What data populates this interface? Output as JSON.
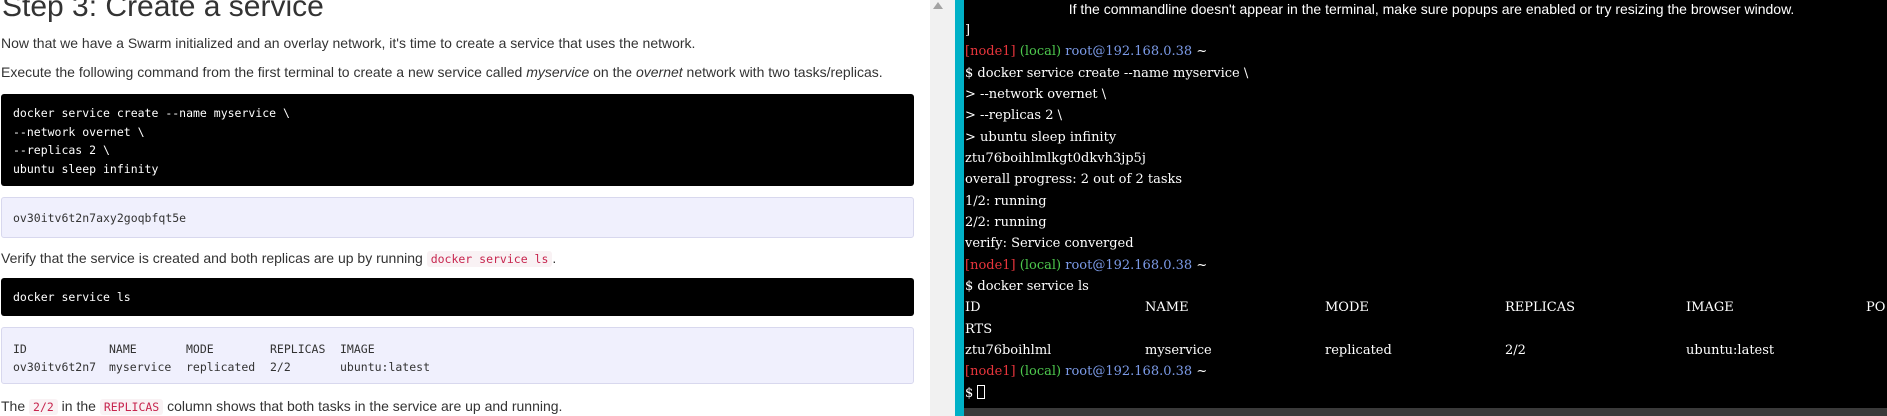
{
  "tutorial": {
    "heading": "Step 3: Create a service",
    "intro": "Now that we have a Swarm initialized and an overlay network, it's time to create a service that uses the network.",
    "instruction_pre": "Execute the following command from the first terminal to create a new service called ",
    "instruction_service": "myservice",
    "instruction_mid": " on the ",
    "instruction_network": "overnet",
    "instruction_post": " network with two tasks/replicas.",
    "create_command_lines": [
      "docker service create --name myservice \\",
      "--network overnet \\",
      "--replicas 2 \\",
      "ubuntu sleep infinity"
    ],
    "create_output": "ov30itv6t2n7axy2goqbfqt5e",
    "verify_pre": "Verify that the service is created and both replicas are up by running ",
    "verify_code": "docker service ls",
    "verify_post": ".",
    "ls_command": "docker service ls",
    "ls_output": {
      "headers": [
        "ID",
        "NAME",
        "MODE",
        "REPLICAS",
        "IMAGE"
      ],
      "row": [
        "ov30itv6t2n7",
        "myservice",
        "replicated",
        "2/2",
        "ubuntu:latest"
      ]
    },
    "final_pre": "The ",
    "final_code1": "2/2",
    "final_mid": " in the ",
    "final_code2": "REPLICAS",
    "final_post": " column shows that both tasks in the service are up and running."
  },
  "terminal": {
    "banner": "If the commandline doesn't appear in the terminal, make sure popups are enabled or try resizing the browser window.",
    "prompt": {
      "node": "[node1]",
      "local": "(local)",
      "host": "root@192.168.0.38",
      "tilde": "~"
    },
    "lines": {
      "stray": "]",
      "cmd1": "$ docker service create --name myservice \\",
      "cont1": "> --network overnet \\",
      "cont2": "> --replicas 2 \\",
      "cont3": "> ubuntu sleep infinity",
      "service_id": "ztu76boihlmlkgt0dkvh3jp5j",
      "progress": "overall progress: 2 out of 2 tasks",
      "task1": "1/2: running",
      "task2": "2/2: running",
      "verify": "verify: Service converged",
      "cmd2": "$ docker service ls",
      "last_prompt": "$ "
    },
    "ls_table": {
      "id_h": "ID",
      "name_h": "NAME",
      "mode_h": "MODE",
      "replicas_h": "REPLICAS",
      "image_h": "IMAGE",
      "ports_h_part1": "PO",
      "ports_h_part2": "RTS",
      "id": "ztu76boihlml",
      "name": "myservice",
      "mode": "replicated",
      "replicas": "2/2",
      "image": "ubuntu:latest"
    }
  }
}
